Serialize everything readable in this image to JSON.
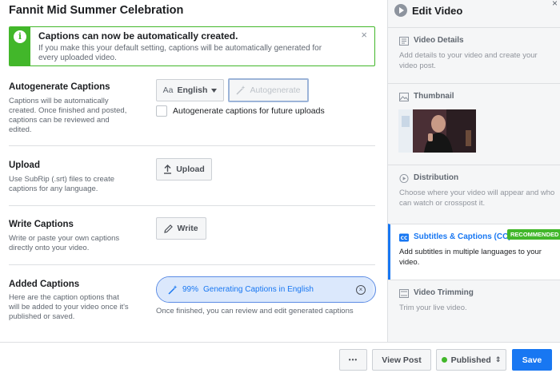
{
  "page_title": "Fannit Mid Summer Celebration",
  "notice": {
    "icon": "info-icon",
    "title": "Captions can now be automatically created.",
    "body": "If you make this your default setting, captions will be automatically generated for every uploaded video.",
    "close": "×"
  },
  "sections": {
    "autogenerate": {
      "title": "Autogenerate Captions",
      "desc": "Captions will be automatically created. Once finished and posted, captions can be reviewed and edited.",
      "language_prefix": "Aa",
      "language": "English",
      "autogenerate_button": "Autogenerate",
      "checkbox_label": "Autogenerate captions for future uploads",
      "checkbox_checked": false
    },
    "upload": {
      "title": "Upload",
      "desc": "Use SubRip (.srt) files to create captions for any language.",
      "button": "Upload"
    },
    "write": {
      "title": "Write Captions",
      "desc": "Write or paste your own captions directly onto your video.",
      "button": "Write"
    },
    "added": {
      "title": "Added Captions",
      "desc": "Here are the caption options that will be added to your video once it's published or saved.",
      "progress_percent_label": "99%",
      "progress_value": 0.99,
      "progress_text": "Generating Captions in English",
      "cancel": "×",
      "note": "Once finished, you can review and edit generated captions"
    }
  },
  "sidebar": {
    "title": "Edit Video",
    "close": "×",
    "items": [
      {
        "title": "Video Details",
        "desc": "Add details to your video and create your video post.",
        "icon": "video-icon"
      },
      {
        "title": "Thumbnail",
        "desc": "",
        "icon": "image-icon"
      },
      {
        "title": "Distribution",
        "desc": "Choose where your video will appear and who can watch or crosspost it.",
        "icon": "play-circle-icon"
      },
      {
        "title": "Subtitles & Captions (CC)",
        "desc": "Add subtitles in multiple languages to your video.",
        "icon": "cc-icon",
        "badge": "RECOMMENDED"
      },
      {
        "title": "Video Trimming",
        "desc": "Trim your live video.",
        "icon": "scissors-icon"
      }
    ]
  },
  "footer": {
    "more": "•••",
    "view_post": "View Post",
    "status": "Published",
    "status_arrow": "⇕",
    "save": "Save"
  },
  "colors": {
    "accent": "#1877f2",
    "success": "#42b72a",
    "progress_border": "#5b8be4"
  }
}
